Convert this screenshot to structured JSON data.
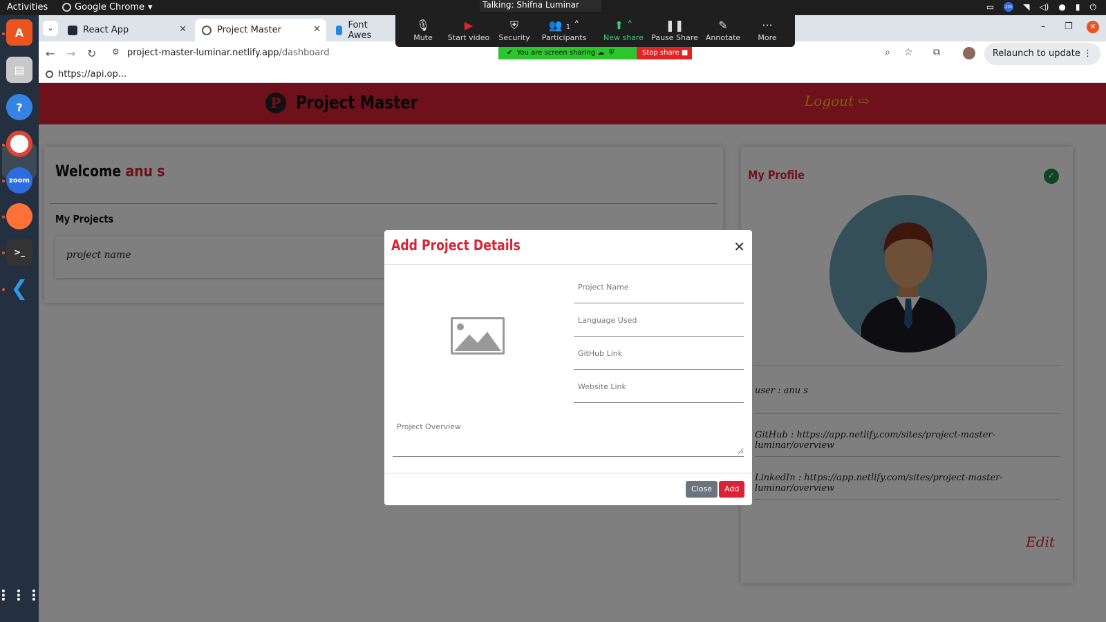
{
  "system": {
    "activities": "Activities",
    "app_name": "Google Chrome",
    "zoom_badge": "zm"
  },
  "browser": {
    "tabs": [
      {
        "label": "React App"
      },
      {
        "label": "Project Master"
      },
      {
        "label": "Font Awes"
      }
    ],
    "url_host": "project-master-luminar.netlify.app",
    "url_path": "/dashboard",
    "relaunch_label": "Relaunch to update",
    "bookmark_label": "https://api.op..."
  },
  "zoom": {
    "talking": "Talking: Shifna Luminar",
    "participants_count": "1",
    "items": [
      {
        "label": "Mute"
      },
      {
        "label": "Start video"
      },
      {
        "label": "Security"
      },
      {
        "label": "Participants"
      },
      {
        "label": "New share"
      },
      {
        "label": "Pause Share"
      },
      {
        "label": "Annotate"
      },
      {
        "label": "More"
      }
    ],
    "sharing_text": "You are screen sharing",
    "stop_share": "Stop share"
  },
  "site": {
    "brand": "Project Master",
    "logout": "Logout",
    "welcome_prefix": "Welcome",
    "welcome_name": "anu s",
    "my_projects": "My Projects",
    "project_name": "project name"
  },
  "profile": {
    "heading": "My Profile",
    "user_line": "user :    anu s",
    "github_line": "GitHub : https://app.netlify.com/sites/project-master-luminar/overview",
    "linkedin_line": "LinkedIn : https://app.netlify.com/sites/project-master-luminar/overview",
    "edit": "Edit"
  },
  "modal": {
    "title": "Add Project Details",
    "project_name_placeholder": "Project Name",
    "language_placeholder": "Language Used",
    "github_placeholder": "GitHub Link",
    "website_placeholder": "Website Link",
    "overview_placeholder": "Project Overview",
    "close_label": "Close",
    "add_label": "Add"
  },
  "colors": {
    "brand_red": "#dc2335",
    "logout_yellow": "#f1c40f",
    "dock_bg": "#24303f"
  }
}
